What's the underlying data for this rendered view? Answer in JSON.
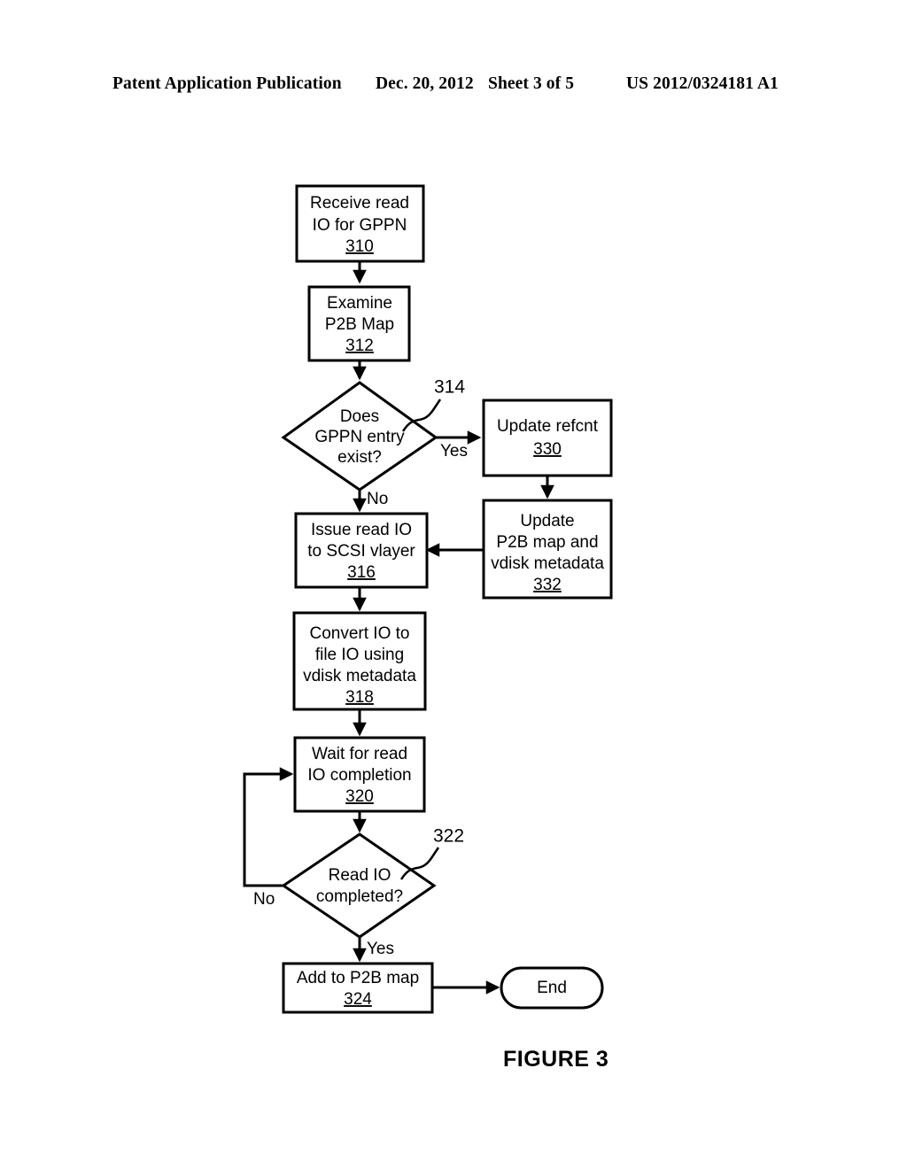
{
  "page": {
    "background_color": "#ffffff",
    "ink_color": "#000000"
  },
  "header": {
    "publication": "Patent Application Publication",
    "date": "Dec. 20, 2012",
    "sheet": "Sheet 3 of 5",
    "document_number": "US 2012/0324181 A1"
  },
  "figure": {
    "caption": "FIGURE 3"
  },
  "nodes": {
    "n310": {
      "ref": "310",
      "line1": "Receive read",
      "line2": "IO for GPPN"
    },
    "n312": {
      "ref": "312",
      "line1": "Examine",
      "line2": "P2B Map"
    },
    "n314": {
      "ref": "314",
      "line1": "Does",
      "line2": "GPPN entry",
      "line3": "exist?"
    },
    "n316": {
      "ref": "316",
      "line1": "Issue read IO",
      "line2": "to SCSI vlayer"
    },
    "n318": {
      "ref": "318",
      "line1": "Convert IO to",
      "line2": "file IO using",
      "line3": "vdisk metadata"
    },
    "n320": {
      "ref": "320",
      "line1": "Wait for read",
      "line2": "IO completion"
    },
    "n322": {
      "ref": "322",
      "line1": "Read IO",
      "line2": "completed?"
    },
    "n324": {
      "ref": "324",
      "line1": "Add to P2B map"
    },
    "n330": {
      "ref": "330",
      "line1": "Update refcnt"
    },
    "n332": {
      "ref": "332",
      "line1": "Update",
      "line2": "P2B map and",
      "line3": "vdisk metadata"
    },
    "end": {
      "label": "End"
    }
  },
  "edge_labels": {
    "yes_314": "Yes",
    "no_314": "No",
    "no_322": "No",
    "yes_322": "Yes"
  }
}
